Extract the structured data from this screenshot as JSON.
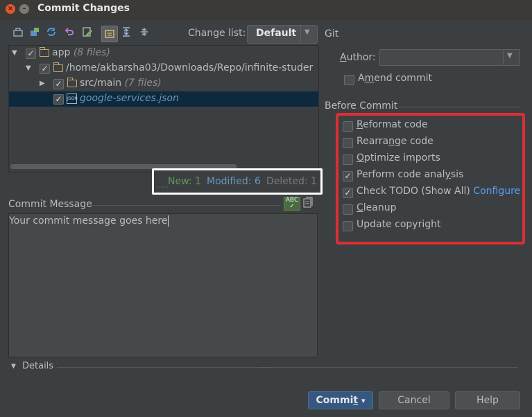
{
  "window": {
    "title": "Commit Changes",
    "close_glyph": "×",
    "min_glyph": "–"
  },
  "toolbar": {
    "icons": [
      "commit-diff-icon",
      "move-changelist-icon",
      "refresh-icon",
      "rollback-icon",
      "edit-source-icon",
      "group-by-directory-icon",
      "expand-all-icon",
      "collapse-all-icon"
    ],
    "change_list_label_pre": "Change list",
    "change_list_label_post": ":",
    "change_list_value": "Default"
  },
  "tree": {
    "rows": [
      {
        "name": "app",
        "extra": "(8 files)"
      },
      {
        "name": "/home/akbarsha03/Downloads/Repo/infinite-studer",
        "extra": ""
      },
      {
        "name": "src/main",
        "extra": "(7 files)"
      },
      {
        "name": "google-services.json",
        "extra": ""
      }
    ]
  },
  "stats": {
    "new": "New: 1",
    "modified": "Modified: 6",
    "deleted": "Deleted: 1"
  },
  "commit_message": {
    "label": "Commit Message",
    "text": "Your commit message goes here"
  },
  "git": {
    "section_label": "Git",
    "author_label_pre": "",
    "author_label_u": "A",
    "author_label_post": "uthor:",
    "author_value": "",
    "amend_label_pre": "A",
    "amend_label_u": "m",
    "amend_label_post": "end commit"
  },
  "before_commit": {
    "section_label": "Before Commit",
    "options": [
      {
        "u": "R",
        "rest": "eformat code",
        "checked": false
      },
      {
        "pre": "Rearra",
        "u": "n",
        "rest": "ge code",
        "checked": false
      },
      {
        "u": "O",
        "rest": "ptimize imports",
        "checked": false
      },
      {
        "pre": "Perform code anal",
        "u": "y",
        "rest": "sis",
        "checked": true
      },
      {
        "pre": "Check TODO (Show All) ",
        "u": "",
        "rest": "",
        "checked": true,
        "link": "Configure"
      },
      {
        "u": "C",
        "rest": "leanup",
        "checked": false
      },
      {
        "pre": "Update copyright",
        "u": "",
        "rest": "",
        "checked": false
      }
    ]
  },
  "details": {
    "label": "Details"
  },
  "buttons": {
    "commit_pre": "Commi",
    "commit_u": "t",
    "commit_arrow": "▾",
    "cancel": "Cancel",
    "help": "Help"
  }
}
